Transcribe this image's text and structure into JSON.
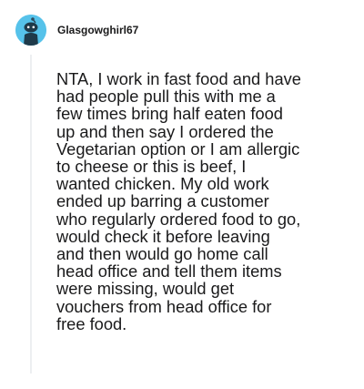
{
  "comment": {
    "username": "Glasgowghirl67",
    "avatar_icon": "snoo-avatar-icon",
    "avatar_color": "#56c2ea",
    "text_lines": [
      "NTA, I work in fast food and have",
      "had people pull this with me a",
      "few times bring half eaten food",
      "up and then say I ordered the",
      "Vegetarian option or I am allergic",
      "to cheese or this is beef, I",
      "wanted chicken. My old work",
      "ended up barring a customer",
      "who regularly ordered food to go,",
      "would check it before leaving",
      "and then would go home call",
      "head office and tell them items",
      "were missing, would get",
      "vouchers from head office for",
      "free food."
    ]
  }
}
